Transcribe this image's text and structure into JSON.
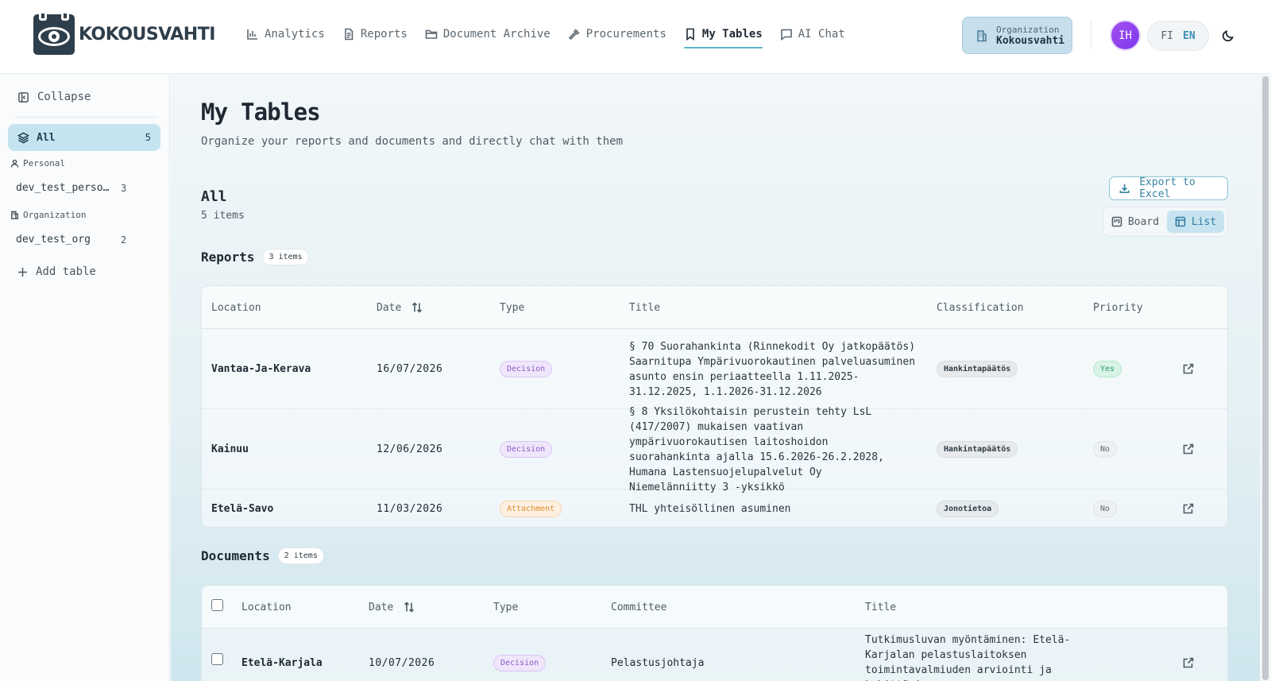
{
  "app": {
    "name": "KOKOUSVAHTI"
  },
  "nav": [
    {
      "label": "Analytics",
      "icon": "bar-chart-icon"
    },
    {
      "label": "Reports",
      "icon": "file-text-icon"
    },
    {
      "label": "Document Archive",
      "icon": "folder-icon"
    },
    {
      "label": "Procurements",
      "icon": "gavel-icon"
    },
    {
      "label": "My Tables",
      "icon": "bookmark-icon",
      "active": true
    },
    {
      "label": "AI Chat",
      "icon": "chat-icon"
    }
  ],
  "org": {
    "label": "Organization",
    "value": "Kokousvahti"
  },
  "user": {
    "initials": "IH"
  },
  "lang": {
    "fi": "FI",
    "en": "EN",
    "active": "EN"
  },
  "sidebar": {
    "collapse": "Collapse",
    "all": {
      "label": "All",
      "count": "5"
    },
    "personal": {
      "label": "Personal",
      "items": [
        {
          "name": "dev_test_personal",
          "count": "3"
        }
      ]
    },
    "organization": {
      "label": "Organization",
      "items": [
        {
          "name": "dev_test_org",
          "count": "2"
        }
      ]
    },
    "add": "Add table"
  },
  "main": {
    "title": "My Tables",
    "subtitle": "Organize your reports and documents and directly chat with them",
    "section_title": "All",
    "section_count": "5 items",
    "export": "Export to Excel",
    "views": {
      "board": "Board",
      "list": "List",
      "active": "List"
    }
  },
  "reports": {
    "name": "Reports",
    "badge": "3 items",
    "headers": {
      "location": "Location",
      "date": "Date",
      "type": "Type",
      "title": "Title",
      "classification": "Classification",
      "priority": "Priority"
    },
    "rows": [
      {
        "location": "Vantaa-Ja-Kerava",
        "date": "16/07/2026",
        "type": "Decision",
        "title": "§ 70 Suorahankinta (Rinnekodit Oy jatkopäätös) Saarnitupa Ympärivuorokautinen palveluasuminen asunto ensin periaatteella 1.11.2025-31.12.2025, 1.1.2026-31.12.2026",
        "classification": "Hankintapäätös",
        "priority": "Yes"
      },
      {
        "location": "Kainuu",
        "date": "12/06/2026",
        "type": "Decision",
        "title": "§ 8 Yksilökohtaisin perustein tehty LsL (417/2007) mukaisen vaativan ympärivuorokautisen laitoshoidon suorahankinta ajalla 15.6.2026-26.2.2028, Humana Lastensuojelupalvelut Oy Niemelänniitty 3 -yksikkö",
        "classification": "Hankintapäätös",
        "priority": "No"
      },
      {
        "location": "Etelä-Savo",
        "date": "11/03/2026",
        "type": "Attachment",
        "title": "THL yhteisöllinen asuminen",
        "classification": "Jonotietoa",
        "priority": "No"
      }
    ]
  },
  "documents": {
    "name": "Documents",
    "badge": "2 items",
    "headers": {
      "location": "Location",
      "date": "Date",
      "type": "Type",
      "committee": "Committee",
      "title": "Title"
    },
    "rows": [
      {
        "location": "Etelä-Karjala",
        "date": "10/07/2026",
        "type": "Decision",
        "committee": "Pelastusjohtaja",
        "title": "Tutkimusluvan myöntäminen: Etelä-Karjalan pelastuslaitoksen toimintavalmiuden arviointi ja kehittäminen"
      }
    ]
  }
}
